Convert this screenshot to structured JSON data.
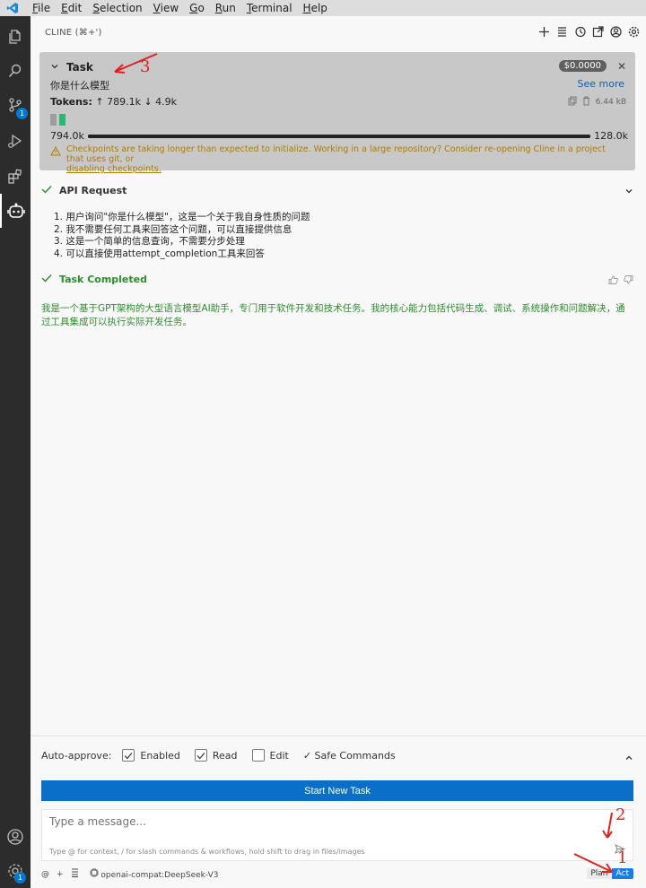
{
  "menubar": {
    "items": [
      "File",
      "Edit",
      "Selection",
      "View",
      "Go",
      "Run",
      "Terminal",
      "Help"
    ],
    "mnemonics": [
      "F",
      "E",
      "S",
      "V",
      "G",
      "R",
      "T",
      "H"
    ]
  },
  "activity": {
    "icons": [
      "explorer-icon",
      "search-icon",
      "source-control-icon",
      "run-debug-icon",
      "extensions-icon",
      "cline-icon",
      "account-icon",
      "manage-gear-icon"
    ],
    "scm_badge": "1",
    "manage_badge": "1"
  },
  "header": {
    "title": "CLINE (⌘+')",
    "actions": [
      "plus-icon",
      "history-list-icon",
      "history-icon",
      "popout-icon",
      "account-icon",
      "settings-icon"
    ]
  },
  "task": {
    "label": "Task",
    "cost": "$0.0000",
    "question": "你是什么模型",
    "see_more": "See more",
    "tokens_label": "Tokens:",
    "tokens_in": "↑ 789.1k",
    "tokens_out": "↓ 4.9k",
    "size": "6.44 kB",
    "ctx_used": "794.0k",
    "ctx_max": "128.0k",
    "ctx_fill_fraction": 1.0,
    "warning": "Checkpoints are taking longer than expected to initialize. Working in a large repository? Consider re-opening Cline in a project that uses git, or",
    "warning_link": "disabling checkpoints."
  },
  "api_request": {
    "label": "API Request",
    "items": [
      "1. 用户询问\"你是什么模型\"，这是一个关于我自身性质的问题",
      "2. 我不需要任何工具来回答这个问题，可以直接提供信息",
      "3. 这是一个简单的信息查询，不需要分步处理",
      "4. 可以直接使用attempt_completion工具来回答"
    ]
  },
  "completed": {
    "label": "Task Completed",
    "answer": "我是一个基于GPT架构的大型语言模型AI助手，专门用于软件开发和技术任务。我的核心能力包括代码生成、调试、系统操作和问题解决，通过工具集成可以执行实际开发任务。"
  },
  "auto_approve": {
    "label": "Auto-approve:",
    "options": [
      "Enabled",
      "Read",
      "Edit"
    ],
    "checked": [
      true,
      true,
      false
    ],
    "safe_commands": "✓ Safe Commands"
  },
  "new_task_button": "Start New Task",
  "message": {
    "placeholder": "Type a message...",
    "hint": "Type @ for context, / for slash commands & workflows, hold shift to drag in files/images"
  },
  "footer": {
    "model": "openai-compat:DeepSeek-V3",
    "plan": "Plan",
    "act": "Act"
  },
  "annotations": {
    "one": "1",
    "two": "2",
    "three": "3",
    "color": "#e02020"
  },
  "colors": {
    "accent": "#0b6fc7",
    "success": "#2e8b2e",
    "warning": "#b07b00",
    "activity_bg": "#2c2c2c"
  }
}
